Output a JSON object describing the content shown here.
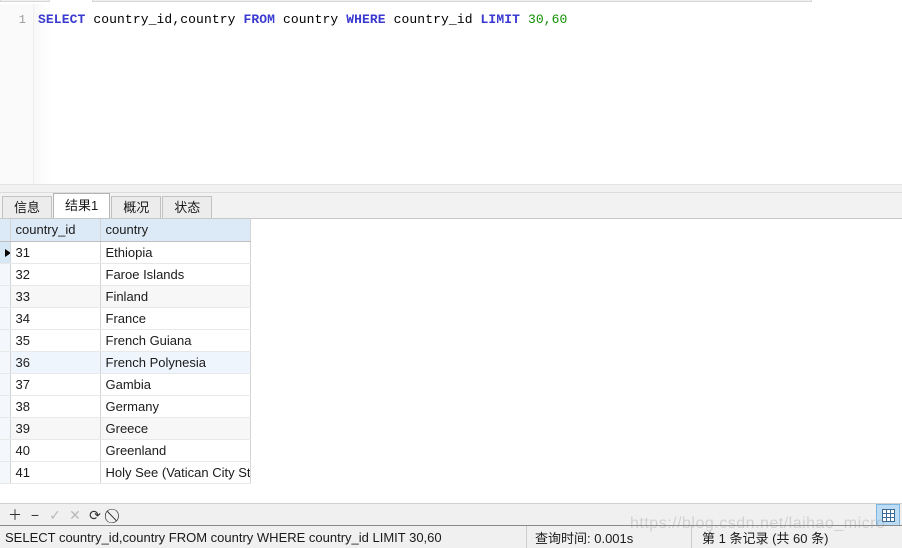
{
  "editor": {
    "line_number": "1",
    "tokens": [
      {
        "text": "SELECT",
        "type": "kw"
      },
      {
        "text": " country_id,country ",
        "type": "id"
      },
      {
        "text": "FROM",
        "type": "kw"
      },
      {
        "text": " country ",
        "type": "id"
      },
      {
        "text": "WHERE",
        "type": "kw"
      },
      {
        "text": " country_id ",
        "type": "id"
      },
      {
        "text": "LIMIT",
        "type": "kw"
      },
      {
        "text": " ",
        "type": "id"
      },
      {
        "text": "30,60",
        "type": "num"
      }
    ],
    "full_text": "SELECT country_id,country FROM country WHERE country_id LIMIT 30,60"
  },
  "tabs": [
    {
      "label": "信息",
      "name": "tab-info",
      "active": false
    },
    {
      "label": "结果1",
      "name": "tab-result-1",
      "active": true
    },
    {
      "label": "概况",
      "name": "tab-profile",
      "active": false
    },
    {
      "label": "状态",
      "name": "tab-status",
      "active": false
    }
  ],
  "grid": {
    "columns": [
      "country_id",
      "country"
    ],
    "rows": [
      {
        "country_id": "31",
        "country": "Ethiopia"
      },
      {
        "country_id": "32",
        "country": "Faroe Islands"
      },
      {
        "country_id": "33",
        "country": "Finland"
      },
      {
        "country_id": "34",
        "country": "France"
      },
      {
        "country_id": "35",
        "country": "French Guiana"
      },
      {
        "country_id": "36",
        "country": "French Polynesia"
      },
      {
        "country_id": "37",
        "country": "Gambia"
      },
      {
        "country_id": "38",
        "country": "Germany"
      },
      {
        "country_id": "39",
        "country": "Greece"
      },
      {
        "country_id": "40",
        "country": "Greenland"
      },
      {
        "country_id": "41",
        "country": "Holy See (Vatican City State)"
      }
    ],
    "current_row_index": 0
  },
  "bottom_toolbar": {
    "buttons": [
      {
        "name": "add-record-button",
        "glyph": "＋",
        "disabled": false
      },
      {
        "name": "delete-record-button",
        "glyph": "−",
        "disabled": false
      },
      {
        "name": "apply-change-button",
        "glyph": "✓",
        "disabled": true
      },
      {
        "name": "cancel-change-button",
        "glyph": "✕",
        "disabled": true
      },
      {
        "name": "refresh-button",
        "glyph": "⟳",
        "disabled": false
      },
      {
        "name": "stop-button",
        "glyph": "⃠",
        "disabled": false
      }
    ],
    "view_toggle_icon": "grid-view-icon"
  },
  "statusbar": {
    "sql": "SELECT country_id,country FROM country WHERE country_id LIMIT 30,60",
    "query_time": "查询时间: 0.001s",
    "record_info": "第 1 条记录 (共 60 条)"
  },
  "watermark": {
    "text": "https://blog.csdn.net/laihao_micro"
  },
  "colors": {
    "keyword": "#3a3ad0",
    "number": "#0f9000",
    "header_bg": "#dceaf7",
    "tab_active_bg": "#ffffff",
    "toggle_bg": "#bcdcf5"
  }
}
